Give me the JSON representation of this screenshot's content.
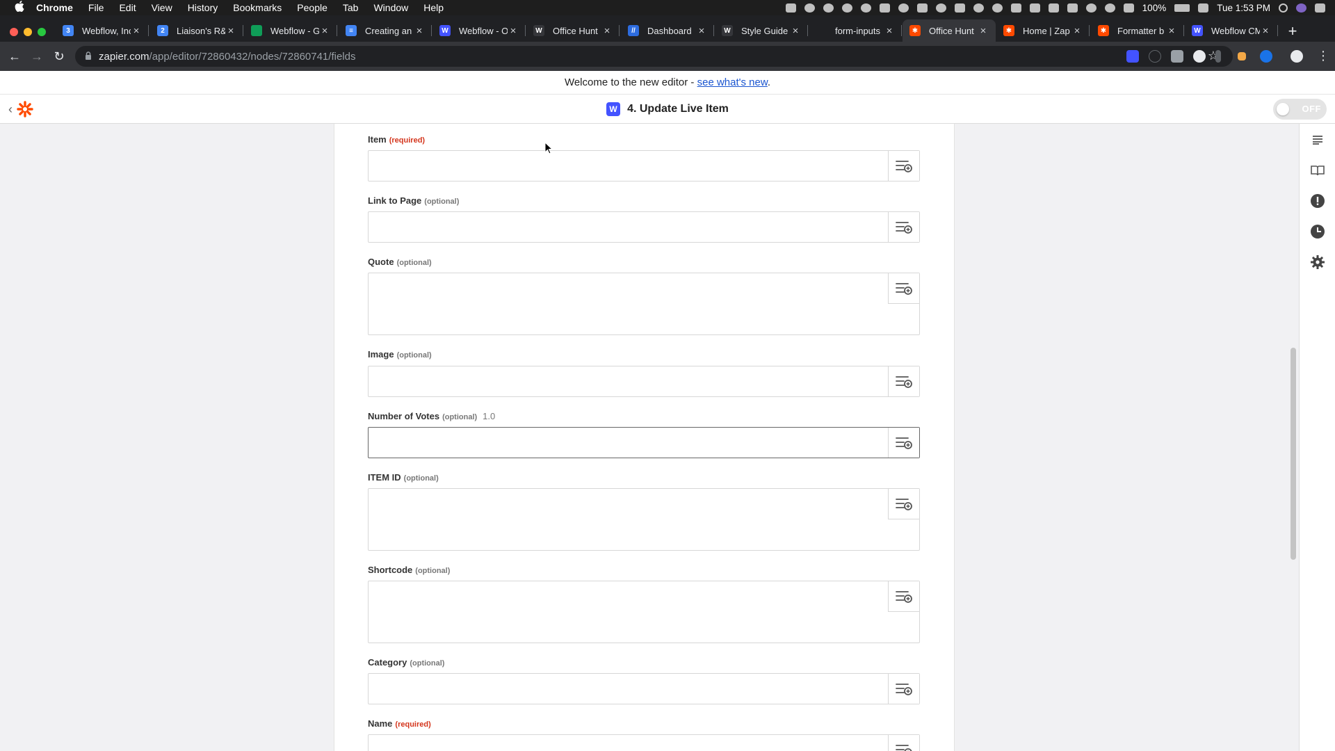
{
  "menubar": {
    "app": "Chrome",
    "items": [
      "File",
      "Edit",
      "View",
      "History",
      "Bookmarks",
      "People",
      "Tab",
      "Window",
      "Help"
    ],
    "battery": "100%",
    "clock": "Tue 1:53 PM"
  },
  "tabs": [
    {
      "title": "Webflow, Inc",
      "fav_color": "#4285f4",
      "fav_text": "3"
    },
    {
      "title": "Liaison's R&",
      "fav_color": "#4285f4",
      "fav_text": "2"
    },
    {
      "title": "Webflow - G",
      "fav_color": "#0f9d58",
      "fav_text": ""
    },
    {
      "title": "Creating an",
      "fav_color": "#4285f4",
      "fav_text": "≡"
    },
    {
      "title": "Webflow - O",
      "fav_color": "#4353ff",
      "fav_text": "W"
    },
    {
      "title": "Office Hunt",
      "fav_color": "#35363a",
      "fav_text": "W"
    },
    {
      "title": "Dashboard",
      "fav_color": "#2d6cdf",
      "fav_text": "//"
    },
    {
      "title": "Style Guide",
      "fav_color": "#35363a",
      "fav_text": "W"
    },
    {
      "title": "form-inputs",
      "fav_color": "#202124",
      "fav_text": ""
    },
    {
      "title": "Office Hunt",
      "fav_color": "#ff4a00",
      "fav_text": "✱",
      "active": true
    },
    {
      "title": "Home | Zap",
      "fav_color": "#ff4a00",
      "fav_text": "✱"
    },
    {
      "title": "Formatter b",
      "fav_color": "#ff4a00",
      "fav_text": "✱"
    },
    {
      "title": "Webflow CM",
      "fav_color": "#4353ff",
      "fav_text": "W"
    }
  ],
  "toolbar": {
    "url_host": "zapier.com",
    "url_path": "/app/editor/72860432/nodes/72860741/fields"
  },
  "banner": {
    "text": "Welcome to the new editor - ",
    "link": "see what's new",
    "suffix": "."
  },
  "header": {
    "app_badge": "W",
    "title": "4. Update Live Item",
    "toggle_label": "OFF"
  },
  "fields": [
    {
      "label": "Item",
      "tag": "(required)",
      "hint": "",
      "value": ""
    },
    {
      "label": "Link to Page",
      "tag": "(optional)",
      "hint": "",
      "value": ""
    },
    {
      "label": "Quote",
      "tag": "(optional)",
      "hint": "",
      "value": ""
    },
    {
      "label": "Image",
      "tag": "(optional)",
      "hint": "",
      "value": ""
    },
    {
      "label": "Number of Votes",
      "tag": "(optional)",
      "hint": "1.0",
      "value": ""
    },
    {
      "label": "ITEM ID",
      "tag": "(optional)",
      "hint": "",
      "value": ""
    },
    {
      "label": "Shortcode",
      "tag": "(optional)",
      "hint": "",
      "value": ""
    },
    {
      "label": "Category",
      "tag": "(optional)",
      "hint": "",
      "value": ""
    },
    {
      "label": "Name",
      "tag": "(required)",
      "hint": "",
      "value": ""
    }
  ],
  "sidebar_icons": [
    "outline-icon",
    "guide-icon",
    "alert-icon",
    "history-icon",
    "settings-icon"
  ],
  "colors": {
    "zapier_orange": "#ff4a00",
    "webflow_blue": "#4353ff",
    "required_red": "#d4351c",
    "link_blue": "#1a55d0"
  }
}
